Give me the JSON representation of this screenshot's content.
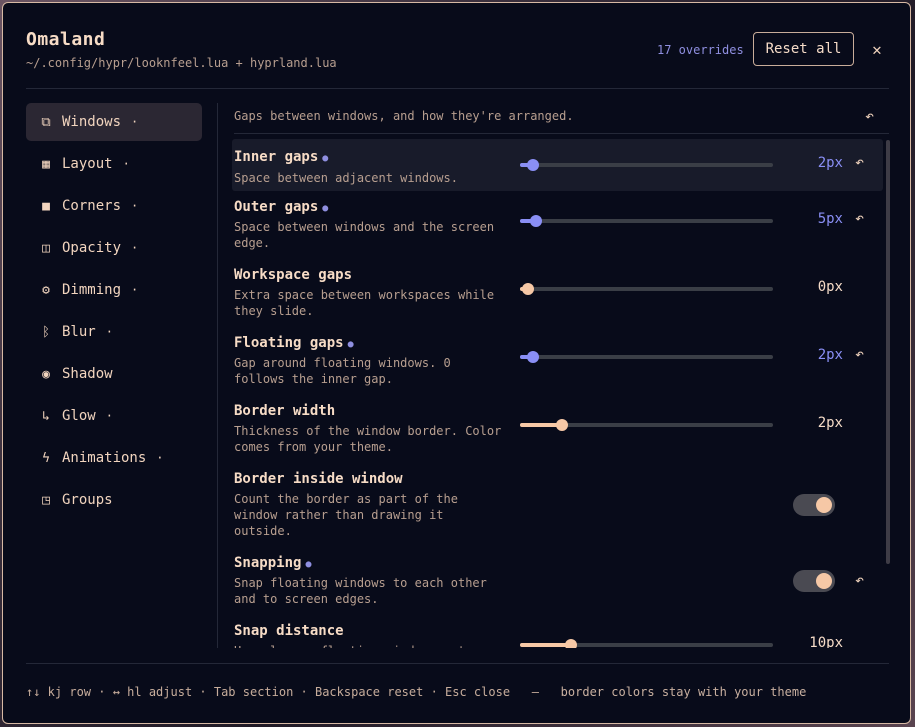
{
  "header": {
    "title": "Omaland",
    "subtitle": "~/.config/hypr/looknfeel.lua + hyprland.lua",
    "overrides": "17 overrides",
    "reset_all": "Reset all",
    "close": "✕"
  },
  "sidebar": {
    "items": [
      {
        "label": "Windows",
        "icon": "windows-icon",
        "glyph": "⧉",
        "dot": "·",
        "active": true
      },
      {
        "label": "Layout",
        "icon": "grid-icon",
        "glyph": "▦",
        "dot": "·"
      },
      {
        "label": "Corners",
        "icon": "square-icon",
        "glyph": "■",
        "dot": "·"
      },
      {
        "label": "Opacity",
        "icon": "opacity-icon",
        "glyph": "◫",
        "dot": "·"
      },
      {
        "label": "Dimming",
        "icon": "gear-icon",
        "glyph": "⚙",
        "dot": "·"
      },
      {
        "label": "Blur",
        "icon": "bluetooth-icon",
        "glyph": "ᛒ",
        "dot": "·"
      },
      {
        "label": "Shadow",
        "icon": "shadow-icon",
        "glyph": "◉",
        "dot": ""
      },
      {
        "label": "Glow",
        "icon": "glow-icon",
        "glyph": "↳",
        "dot": "·"
      },
      {
        "label": "Animations",
        "icon": "bolt-icon",
        "glyph": "ϟ",
        "dot": "·"
      },
      {
        "label": "Groups",
        "icon": "groups-icon",
        "glyph": "◳",
        "dot": ""
      }
    ]
  },
  "section": {
    "description": "Gaps between windows, and how they're arranged.",
    "undo": "↶"
  },
  "settings": [
    {
      "title": "Inner gaps",
      "modified": true,
      "desc": "Space between adjacent windows.",
      "type": "slider",
      "fill": 0.05,
      "value": "2px"
    },
    {
      "title": "Outer gaps",
      "modified": true,
      "desc": "Space between windows and the screen edge.",
      "type": "slider",
      "fill": 0.065,
      "value": "5px"
    },
    {
      "title": "Workspace gaps",
      "modified": false,
      "desc": "Extra space between workspaces while they slide.",
      "type": "slider",
      "fill": 0.03,
      "value": "0px"
    },
    {
      "title": "Floating gaps",
      "modified": true,
      "desc": "Gap around floating windows. 0 follows the inner gap.",
      "type": "slider",
      "fill": 0.05,
      "value": "2px"
    },
    {
      "title": "Border width",
      "modified": false,
      "desc": "Thickness of the window border. Color comes from your theme.",
      "type": "slider",
      "fill": 0.165,
      "value": "2px"
    },
    {
      "title": "Border inside window",
      "modified": false,
      "desc": "Count the border as part of the window rather than drawing it outside.",
      "type": "toggle",
      "on": true
    },
    {
      "title": "Snapping",
      "modified": true,
      "desc": "Snap floating windows to each other and to screen edges.",
      "type": "toggle",
      "on": true
    },
    {
      "title": "Snap distance",
      "modified": false,
      "desc": "How close a floating window must",
      "type": "slider",
      "fill": 0.2,
      "value": "10px"
    }
  ],
  "colors": {
    "accent": "#8a8ff5",
    "peach": "#f6c8a6",
    "background": "#080b1a",
    "border": "#d7b9a4"
  },
  "footer": {
    "hints": "↑↓ kj row · ↔ hl adjust · Tab section · Backspace reset · Esc close",
    "separator": "—",
    "note": "border colors stay with your theme"
  }
}
